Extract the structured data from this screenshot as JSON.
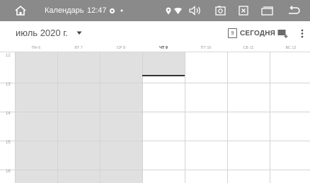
{
  "status_bar": {
    "app_name": "Календарь",
    "time": "12:47",
    "icons": [
      "home-icon",
      "android-settings-icon",
      "dot-icon",
      "location-icon",
      "wifi-icon",
      "volume-icon",
      "screenshot-icon",
      "close-box-icon",
      "window-icon",
      "back-icon"
    ]
  },
  "toolbar": {
    "month_label": "июль 2020 г.",
    "today_day": "9",
    "today_label": "СЕГОДНЯ"
  },
  "days": [
    {
      "label": "ПН 6",
      "past": true
    },
    {
      "label": "ВТ 7",
      "past": true
    },
    {
      "label": "СР 8",
      "past": true
    },
    {
      "label": "ЧТ 9",
      "past": false,
      "today": true
    },
    {
      "label": "ПТ 10",
      "past": false
    },
    {
      "label": "СБ 11",
      "past": false
    },
    {
      "label": "ВС 12",
      "past": false
    }
  ],
  "hours": [
    "12",
    "13",
    "14",
    "15",
    "16"
  ],
  "colors": {
    "status_bar": "#8a8a8a",
    "past_day": "#e0e0e0",
    "grid_line": "#d4d4d4",
    "now_line": "#333333"
  }
}
